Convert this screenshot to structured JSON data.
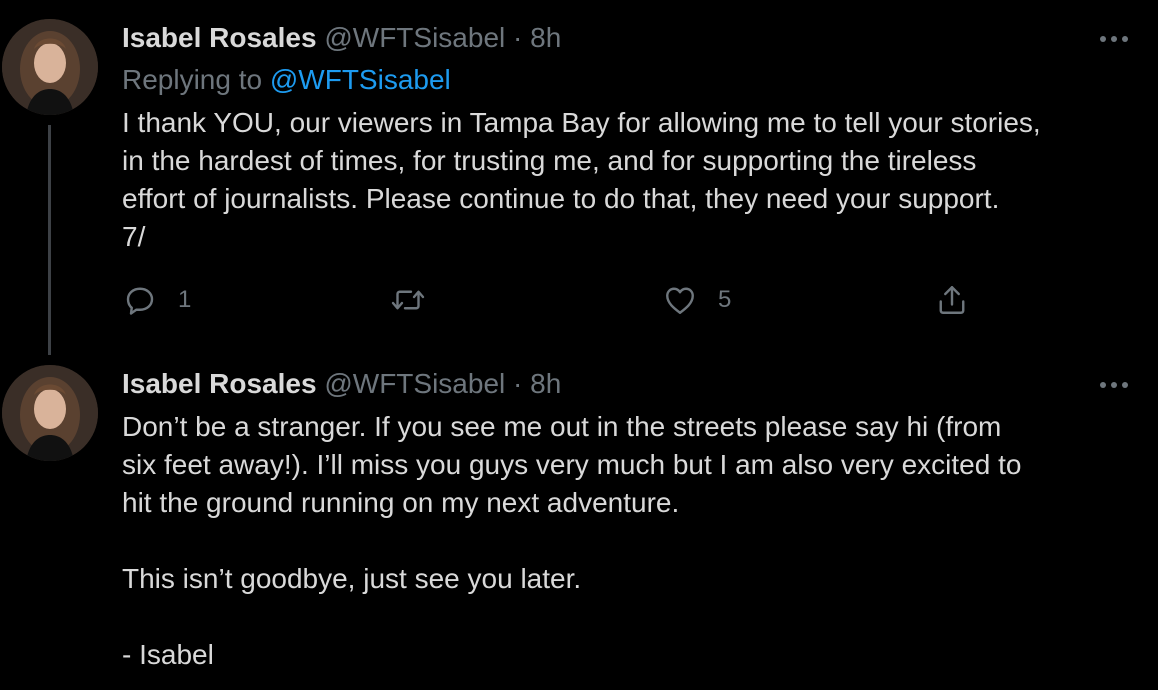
{
  "tweets": [
    {
      "name": "Isabel Rosales",
      "handle": "@WFTSisabel",
      "separator": "·",
      "time": "8h",
      "replying_prefix": "Replying to",
      "replying_to": "@WFTSisabel",
      "text_lines": [
        "I thank YOU, our viewers in Tampa Bay for allowing me to tell your stories,",
        "in the hardest of times, for trusting me, and for supporting the tireless",
        "effort of journalists. Please continue to do that, they need your support.",
        "7/"
      ],
      "actions": {
        "reply_icon": "reply-icon",
        "reply_count": "1",
        "retweet_icon": "retweet-icon",
        "retweet_count": "",
        "like_icon": "heart-icon",
        "like_count": "5",
        "share_icon": "share-icon"
      },
      "more_icon": "more-icon"
    },
    {
      "name": "Isabel Rosales",
      "handle": "@WFTSisabel",
      "separator": "·",
      "time": "8h",
      "paragraphs": [
        [
          "Don’t be a stranger. If you see me out in the streets please say hi (from",
          "six feet away!). I’ll miss you guys very much but I am also very excited to",
          "hit the ground running on my next adventure."
        ],
        [
          "This isn’t goodbye, just see you later."
        ],
        [
          "- Isabel"
        ]
      ],
      "more_icon": "more-icon"
    }
  ],
  "colors": {
    "background": "#000000",
    "text": "#d9d9d9",
    "secondary": "#6e767d",
    "link": "#1d9bf0",
    "thread_line": "#3d4146"
  }
}
